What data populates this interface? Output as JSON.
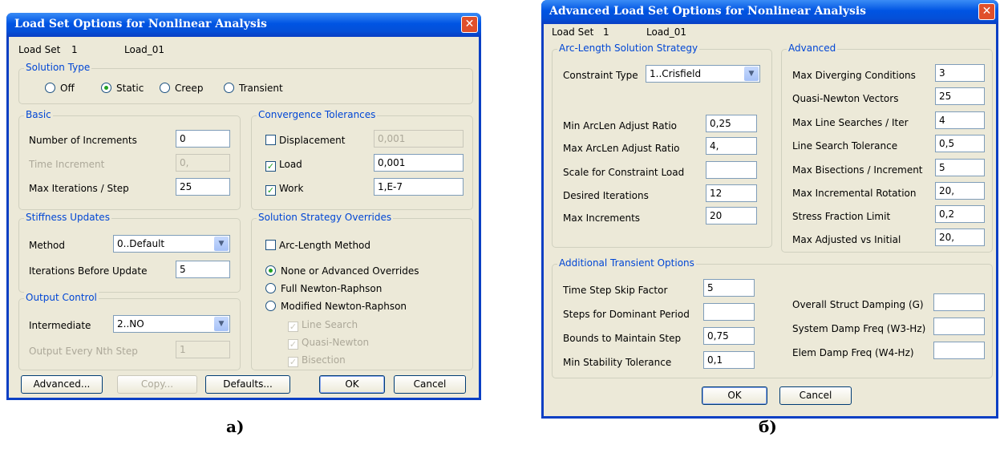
{
  "caption_a": "a)",
  "caption_b": "б)",
  "d1": {
    "title": "Load Set Options for Nonlinear Analysis",
    "load_set_label": "Load Set",
    "load_set_num": "1",
    "load_set_name": "Load_01",
    "solution_type": {
      "label": "Solution Type",
      "options": [
        "Off",
        "Static",
        "Creep",
        "Transient"
      ],
      "selected": "Static"
    },
    "basic": {
      "label": "Basic",
      "num_increments_label": "Number of Increments",
      "num_increments": "0",
      "time_increment_label": "Time Increment",
      "time_increment": "0,",
      "max_iter_label": "Max Iterations / Step",
      "max_iter": "25"
    },
    "conv": {
      "label": "Convergence Tolerances",
      "displacement_label": "Displacement",
      "displacement_checked": false,
      "displacement": "0,001",
      "load_label": "Load",
      "load_checked": true,
      "load": "0,001",
      "work_label": "Work",
      "work_checked": true,
      "work": "1,E-7"
    },
    "stiff": {
      "label": "Stiffness Updates",
      "method_label": "Method",
      "method": "0..Default",
      "iter_before_label": "Iterations Before Update",
      "iter_before": "5"
    },
    "sso": {
      "label": "Solution Strategy Overrides",
      "arc_label": "Arc-Length Method",
      "arc_checked": false,
      "opt_none": "None or Advanced Overrides",
      "opt_full": "Full Newton-Raphson",
      "opt_mod": "Modified Newton-Raphson",
      "selected": "None or Advanced Overrides",
      "line_search": "Line Search",
      "quasi_newton": "Quasi-Newton",
      "bisection": "Bisection"
    },
    "output": {
      "label": "Output Control",
      "intermediate_label": "Intermediate",
      "intermediate": "2..NO",
      "every_label": "Output Every Nth Step",
      "every": "1"
    },
    "buttons": {
      "advanced": "Advanced...",
      "copy": "Copy...",
      "defaults": "Defaults...",
      "ok": "OK",
      "cancel": "Cancel"
    }
  },
  "d2": {
    "title": "Advanced Load Set Options for Nonlinear Analysis",
    "load_set_label": "Load Set",
    "load_set_num": "1",
    "load_set_name": "Load_01",
    "arc": {
      "label": "Arc-Length Solution Strategy",
      "constraint_label": "Constraint Type",
      "constraint": "1..Crisfield",
      "min_ratio_label": "Min ArcLen Adjust Ratio",
      "min_ratio": "0,25",
      "max_ratio_label": "Max ArcLen Adjust Ratio",
      "max_ratio": "4,",
      "scale_label": "Scale for Constraint Load",
      "scale": "",
      "desired_label": "Desired Iterations",
      "desired": "12",
      "max_inc_label": "Max Increments",
      "max_inc": "20"
    },
    "adv": {
      "label": "Advanced",
      "diverging_label": "Max Diverging Conditions",
      "diverging": "3",
      "qn_label": "Quasi-Newton Vectors",
      "qn": "25",
      "line_searches_label": "Max Line Searches / Iter",
      "line_searches": "4",
      "ls_tol_label": "Line Search Tolerance",
      "ls_tol": "0,5",
      "bisections_label": "Max Bisections / Increment",
      "bisections": "5",
      "rotation_label": "Max Incremental Rotation",
      "rotation": "20,",
      "stress_label": "Stress Fraction Limit",
      "stress": "0,2",
      "adjusted_label": "Max Adjusted vs Initial",
      "adjusted": "20,"
    },
    "trans": {
      "label": "Additional Transient Options",
      "skip_label": "Time Step Skip Factor",
      "skip": "5",
      "dominant_label": "Steps for Dominant Period",
      "dominant": "",
      "bounds_label": "Bounds to Maintain Step",
      "bounds": "0,75",
      "stability_label": "Min Stability Tolerance",
      "stability": "0,1",
      "damping_label": "Overall Struct Damping (G)",
      "damping": "",
      "w3_label": "System Damp Freq (W3-Hz)",
      "w3": "",
      "w4_label": "Elem Damp Freq (W4-Hz)",
      "w4": ""
    },
    "buttons": {
      "ok": "OK",
      "cancel": "Cancel"
    }
  }
}
